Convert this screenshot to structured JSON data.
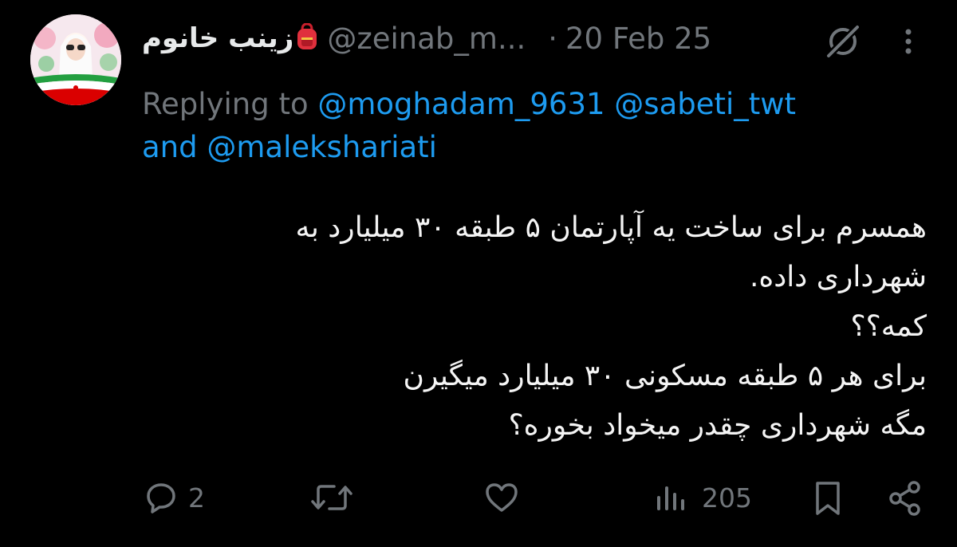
{
  "tweet": {
    "display_name": "زینب خانوم",
    "name_emoji": "🎒",
    "handle": "@zeinab_m...",
    "separator": "·",
    "date": "20 Feb 25",
    "replying_prefix": "Replying to",
    "mentions": [
      "@moghadam_9631",
      "@sabeti_twt",
      "@malekshariati"
    ],
    "mention_joiner": "and",
    "body_lines": [
      "همسرم برای ساخت یه آپارتمان ۵ طبقه ۳۰ میلیارد به",
      "شهرداری داده.",
      "کمه؟؟",
      "برای هر ۵ طبقه مسکونی ۳۰ میلیارد میگیرن",
      "مگه شهرداری چقدر میخواد بخوره؟"
    ]
  },
  "actions": {
    "replies": "2",
    "views": "205"
  },
  "icons": {
    "grok": "grok-icon",
    "more": "more-vertical-icon",
    "reply": "reply-icon",
    "retweet": "retweet-icon",
    "like": "heart-icon",
    "views": "analytics-icon",
    "bookmark": "bookmark-icon",
    "share": "share-icon"
  },
  "colors": {
    "background": "#000000",
    "text": "#e7e9ea",
    "muted": "#71767b",
    "link": "#1d9bf0"
  }
}
